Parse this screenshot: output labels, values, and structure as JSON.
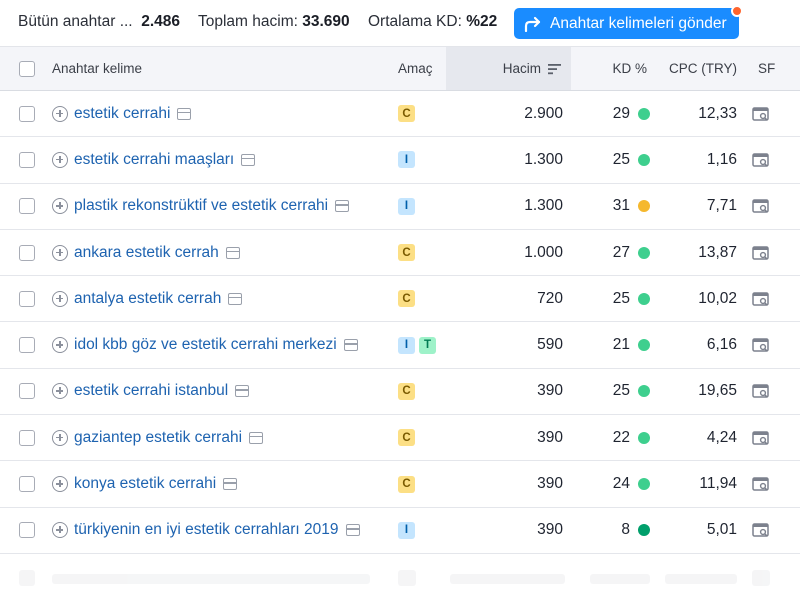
{
  "summary": {
    "all_keywords_label": "Bütün anahtar ...",
    "all_keywords_value": "2.486",
    "total_volume_label": "Toplam hacim:",
    "total_volume_value": "33.690",
    "avg_kd_label": "Ortalama KD:",
    "avg_kd_value": "%22",
    "send_button_label": "Anahtar kelimeleri gönder"
  },
  "columns": {
    "keyword": "Anahtar kelime",
    "intent": "Amaç",
    "volume": "Hacim",
    "kd": "KD %",
    "cpc": "CPC (TRY)",
    "sf": "SF"
  },
  "colors": {
    "accent": "#1a8cff",
    "kd_easy": "#3ecf8e",
    "kd_medium": "#f5b82e",
    "kd_very_easy": "#009f6b"
  },
  "rows": [
    {
      "keyword": "estetik cerrahi",
      "intents": [
        "C"
      ],
      "volume": "2.900",
      "kd": "29",
      "kd_color": "#3ecf8e",
      "cpc": "12,33"
    },
    {
      "keyword": "estetik cerrahi maaşları",
      "intents": [
        "I"
      ],
      "volume": "1.300",
      "kd": "25",
      "kd_color": "#3ecf8e",
      "cpc": "1,16"
    },
    {
      "keyword": "plastik rekonstrüktif ve estetik cerrahi",
      "intents": [
        "I"
      ],
      "volume": "1.300",
      "kd": "31",
      "kd_color": "#f5b82e",
      "cpc": "7,71"
    },
    {
      "keyword": "ankara estetik cerrah",
      "intents": [
        "C"
      ],
      "volume": "1.000",
      "kd": "27",
      "kd_color": "#3ecf8e",
      "cpc": "13,87"
    },
    {
      "keyword": "antalya estetik cerrah",
      "intents": [
        "C"
      ],
      "volume": "720",
      "kd": "25",
      "kd_color": "#3ecf8e",
      "cpc": "10,02"
    },
    {
      "keyword": "idol kbb göz ve estetik cerrahi merkezi",
      "intents": [
        "I",
        "T"
      ],
      "volume": "590",
      "kd": "21",
      "kd_color": "#3ecf8e",
      "cpc": "6,16"
    },
    {
      "keyword": "estetik cerrahi istanbul",
      "intents": [
        "C"
      ],
      "volume": "390",
      "kd": "25",
      "kd_color": "#3ecf8e",
      "cpc": "19,65"
    },
    {
      "keyword": "gaziantep estetik cerrahi",
      "intents": [
        "C"
      ],
      "volume": "390",
      "kd": "22",
      "kd_color": "#3ecf8e",
      "cpc": "4,24"
    },
    {
      "keyword": "konya estetik cerrahi",
      "intents": [
        "C"
      ],
      "volume": "390",
      "kd": "24",
      "kd_color": "#3ecf8e",
      "cpc": "11,94"
    },
    {
      "keyword": "türkiyenin en iyi estetik cerrahları 2019",
      "intents": [
        "I"
      ],
      "volume": "390",
      "kd": "8",
      "kd_color": "#009f6b",
      "cpc": "5,01"
    }
  ]
}
